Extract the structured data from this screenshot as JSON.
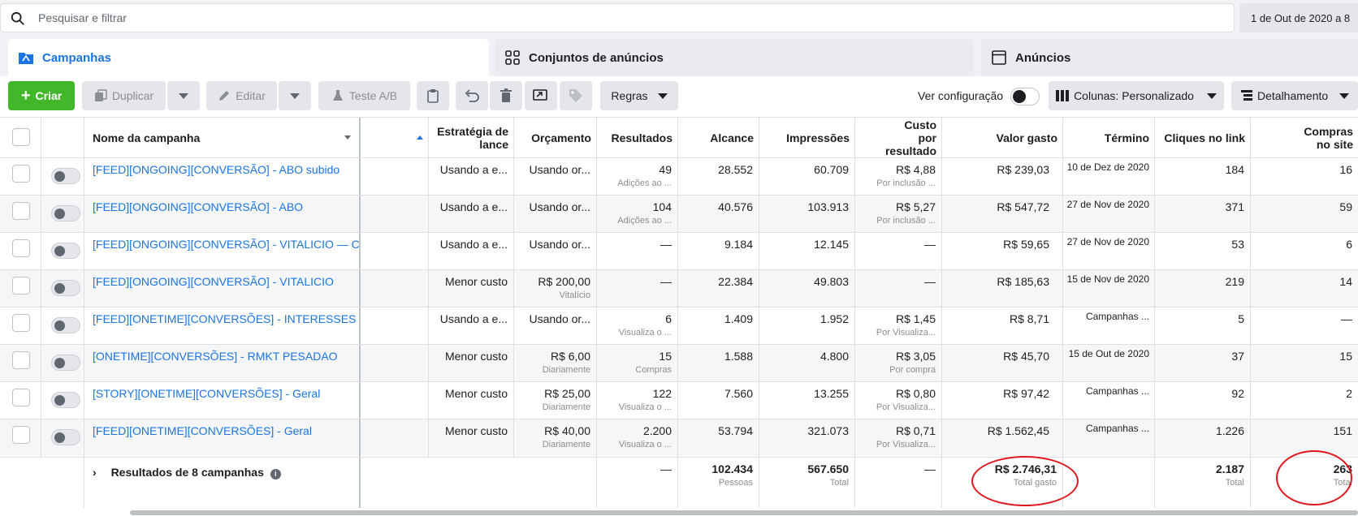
{
  "search": {
    "placeholder": "Pesquisar e filtrar"
  },
  "date_range": "1 de Out de 2020 a 8",
  "tabs": [
    {
      "label": "Campanhas"
    },
    {
      "label": "Conjuntos de anúncios"
    },
    {
      "label": "Anúncios"
    }
  ],
  "toolbar": {
    "create": "Criar",
    "duplicate": "Duplicar",
    "edit": "Editar",
    "ab_test": "Teste A/B",
    "rules": "Regras",
    "view_setting": "Ver configuração",
    "columns": "Colunas: Personalizado",
    "breakdown": "Detalhamento"
  },
  "columns": {
    "name": "Nome da campanha",
    "bid": "Estratégia de lance",
    "budget": "Orçamento",
    "results": "Resultados",
    "reach": "Alcance",
    "impressions": "Impressões",
    "cost": "Custo por resultado",
    "spent": "Valor gasto",
    "end": "Término",
    "clicks": "Cliques no link",
    "purchases": "Compras no site"
  },
  "rows": [
    {
      "name": "[FEED][ONGOING][CONVERSÃO] - ABO subido",
      "bid": "Usando a e...",
      "budget": "Usando or...",
      "budget_sub": "",
      "results": "49",
      "results_sub": "Adições ao ...",
      "reach": "28.552",
      "impressions": "60.709",
      "cost": "R$ 4,88",
      "cost_sub": "Por inclusão ...",
      "spent": "R$ 239,03",
      "end": "10 de Dez de 2020",
      "clicks": "184",
      "purchases": "16"
    },
    {
      "name": "[FEED][ONGOING][CONVERSÃO] - ABO",
      "bid": "Usando a e...",
      "budget": "Usando or...",
      "budget_sub": "",
      "results": "104",
      "results_sub": "Adições ao ...",
      "reach": "40.576",
      "impressions": "103.913",
      "cost": "R$ 5,27",
      "cost_sub": "Por inclusão ...",
      "spent": "R$ 547,72",
      "end": "27 de Nov de 2020",
      "clicks": "371",
      "purchases": "59"
    },
    {
      "name": "[FEED][ONGOING][CONVERSÃO] - VITALICIO — C...",
      "bid": "Usando a e...",
      "budget": "Usando or...",
      "budget_sub": "",
      "results": "—",
      "results_sub": "",
      "reach": "9.184",
      "impressions": "12.145",
      "cost": "—",
      "cost_sub": "",
      "spent": "R$ 59,65",
      "end": "27 de Nov de 2020",
      "clicks": "53",
      "purchases": "6"
    },
    {
      "name": "[FEED][ONGOING][CONVERSÃO] - VITALICIO",
      "bid": "Menor custo",
      "budget": "R$ 200,00",
      "budget_sub": "Vitalício",
      "results": "—",
      "results_sub": "",
      "reach": "22.384",
      "impressions": "49.803",
      "cost": "—",
      "cost_sub": "",
      "spent": "R$ 185,63",
      "end": "15 de Nov de 2020",
      "clicks": "219",
      "purchases": "14"
    },
    {
      "name": "[FEED][ONETIME][CONVERSÕES] - INTERESSES ...",
      "bid": "Usando a e...",
      "budget": "Usando or...",
      "budget_sub": "",
      "results": "6",
      "results_sub": "Visualiza o ...",
      "reach": "1.409",
      "impressions": "1.952",
      "cost": "R$ 1,45",
      "cost_sub": "Por Visualiza...",
      "spent": "R$ 8,71",
      "end": "Campanhas ...",
      "clicks": "5",
      "purchases": "—"
    },
    {
      "name": "[ONETIME][CONVERSÕES] - RMKT PESADAO",
      "bid": "Menor custo",
      "budget": "R$ 6,00",
      "budget_sub": "Diariamente",
      "results": "15",
      "results_sub": "Compras",
      "reach": "1.588",
      "impressions": "4.800",
      "cost": "R$ 3,05",
      "cost_sub": "Por compra",
      "spent": "R$ 45,70",
      "end": "15 de Out de 2020",
      "clicks": "37",
      "purchases": "15"
    },
    {
      "name": "[STORY][ONETIME][CONVERSÕES] - Geral",
      "bid": "Menor custo",
      "budget": "R$ 25,00",
      "budget_sub": "Diariamente",
      "results": "122",
      "results_sub": "Visualiza o ...",
      "reach": "7.560",
      "impressions": "13.255",
      "cost": "R$ 0,80",
      "cost_sub": "Por Visualiza...",
      "spent": "R$ 97,42",
      "end": "Campanhas ...",
      "clicks": "92",
      "purchases": "2"
    },
    {
      "name": "[FEED][ONETIME][CONVERSÕES] - Geral",
      "bid": "Menor custo",
      "budget": "R$ 40,00",
      "budget_sub": "Diariamente",
      "results": "2.200",
      "results_sub": "Visualiza o ...",
      "reach": "53.794",
      "impressions": "321.073",
      "cost": "R$ 0,71",
      "cost_sub": "Por Visualiza...",
      "spent": "R$ 1.562,45",
      "end": "Campanhas ...",
      "clicks": "1.226",
      "purchases": "151"
    }
  ],
  "summary": {
    "label": "Resultados de 8 campanhas",
    "results": "—",
    "reach": "102.434",
    "reach_sub": "Pessoas",
    "impressions": "567.650",
    "impressions_sub": "Total",
    "cost": "—",
    "spent": "R$ 2.746,31",
    "spent_sub": "Total gasto",
    "clicks": "2.187",
    "clicks_sub": "Total",
    "purchases": "263",
    "purchases_sub": "Total"
  },
  "colors": {
    "accent": "#1b74e4",
    "create": "#42b72a",
    "annotation": "#e0161a"
  }
}
